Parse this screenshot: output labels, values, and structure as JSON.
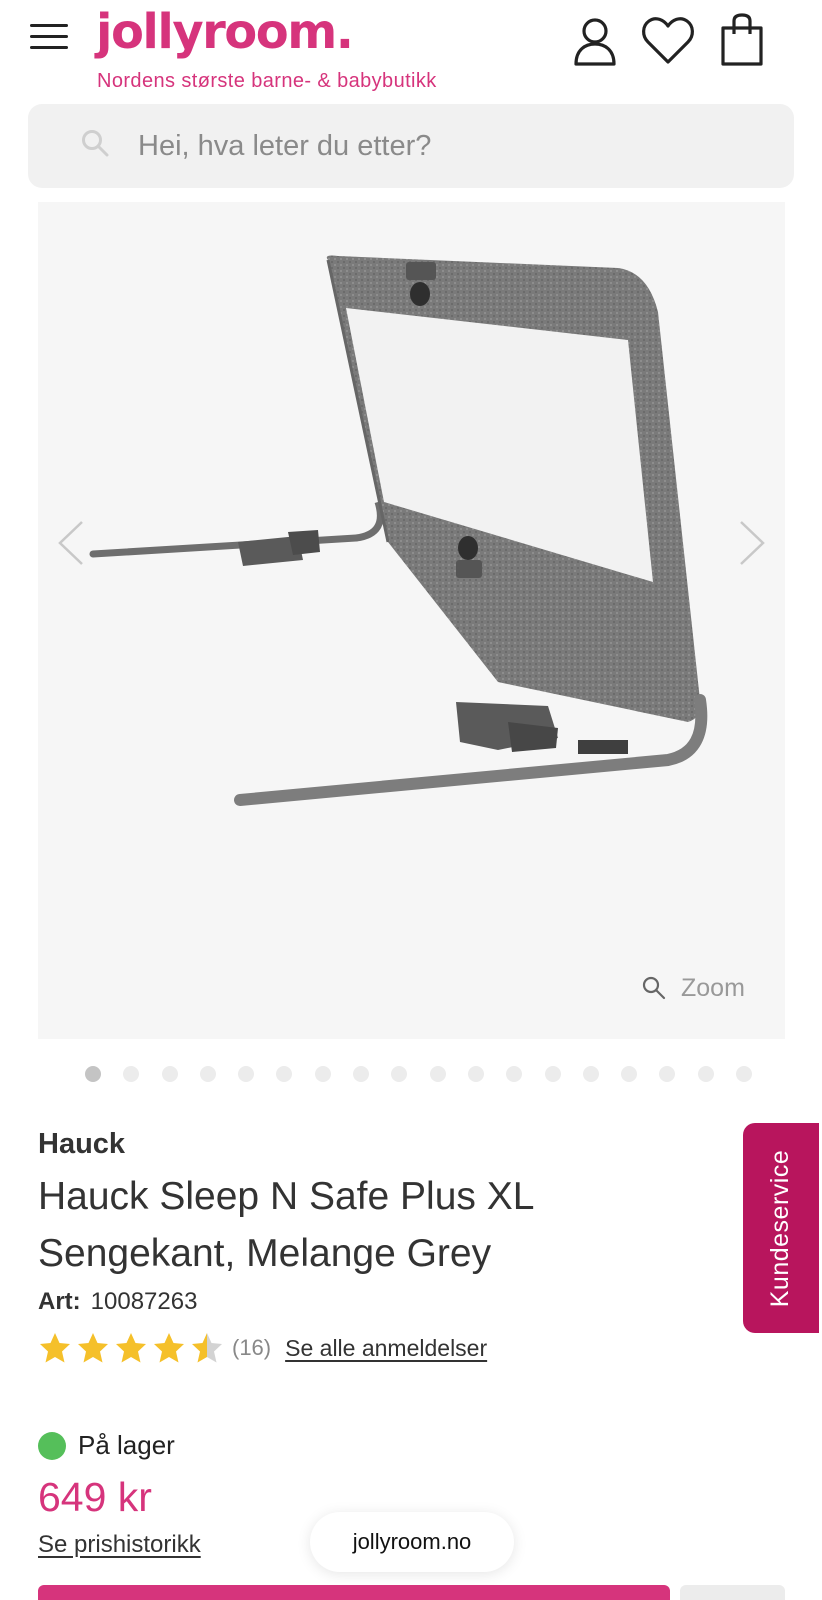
{
  "header": {
    "logo": "jollyroom.",
    "tagline": "Nordens største barne- & babybutikk",
    "icons": [
      "menu-icon",
      "account-icon",
      "heart-icon",
      "shopping-bag-icon"
    ]
  },
  "search": {
    "placeholder": "Hei, hva leter du etter?"
  },
  "gallery": {
    "zoom_label": "Zoom",
    "image_count": 18,
    "active_index": 0
  },
  "product": {
    "brand": "Hauck",
    "title": "Hauck Sleep N Safe Plus XL Sengekant, Melange Grey",
    "art_label": "Art:",
    "art_number": "10087263",
    "rating": 4.5,
    "rating_max": 5,
    "review_count": "(16)",
    "reviews_link": "Se alle anmeldelser",
    "stock_status": "På lager",
    "price": "649 kr",
    "price_history_link": "Se prishistorikk"
  },
  "side_tab": {
    "label": "Kundeservice"
  },
  "browser": {
    "domain": "jollyroom.no"
  },
  "colors": {
    "brand_pink": "#d6347c",
    "side_tab": "#b8155d",
    "star": "#f5c02a",
    "stock_green": "#55bf5a"
  }
}
